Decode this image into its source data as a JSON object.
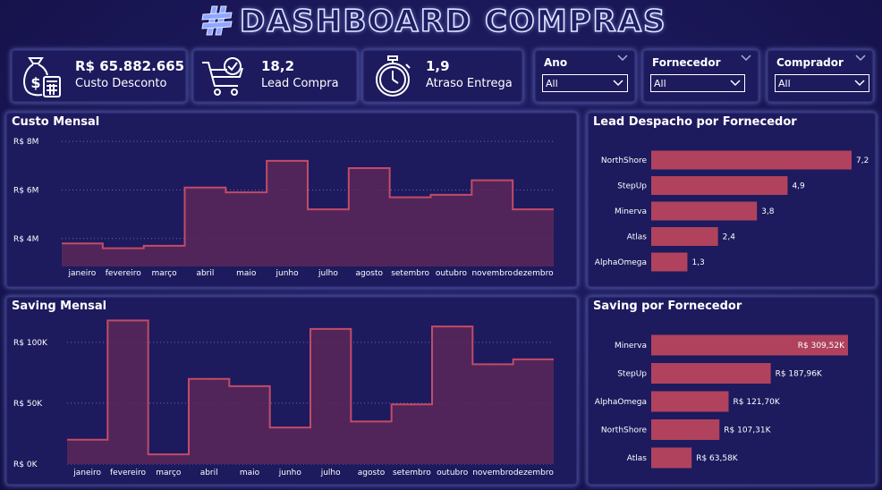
{
  "header": {
    "title": "DASHBOARD COMPRAS"
  },
  "kpis": [
    {
      "icon": "money-bag-calculator-icon",
      "value": "R$ 65.882.665",
      "label": "Custo Desconto"
    },
    {
      "icon": "shopping-cart-check-icon",
      "value": "18,2",
      "label": "Lead Compra"
    },
    {
      "icon": "stopwatch-icon",
      "value": "1,9",
      "label": "Atraso Entrega"
    }
  ],
  "filters": [
    {
      "label": "Ano",
      "value": "All"
    },
    {
      "label": "Fornecedor",
      "value": "All"
    },
    {
      "label": "Comprador",
      "value": "All"
    }
  ],
  "colors": {
    "accent": "#b0425e",
    "area_fill": "#5a2858",
    "line": "#c34b68",
    "background": "#1a1757"
  },
  "chart_data": [
    {
      "type": "area",
      "title": "Custo Mensal",
      "categories": [
        "janeiro",
        "fevereiro",
        "março",
        "abril",
        "maio",
        "junho",
        "julho",
        "agosto",
        "setembro",
        "outubro",
        "novembro",
        "dezembro"
      ],
      "values": [
        3.8,
        3.6,
        3.7,
        6.1,
        5.9,
        7.2,
        5.2,
        6.9,
        5.7,
        5.8,
        6.4,
        5.2
      ],
      "yticks": [
        "R$ 8M",
        "R$ 6M",
        "R$ 4M"
      ],
      "ytick_values": [
        8,
        6,
        4
      ],
      "ylim": [
        2.85,
        8.3
      ],
      "step": true
    },
    {
      "type": "bar",
      "title": "Lead Despacho por Fornecedor",
      "orientation": "horizontal",
      "categories": [
        "NorthShore",
        "StepUp",
        "Minerva",
        "Atlas",
        "AlphaOmega"
      ],
      "values": [
        7.2,
        4.9,
        3.8,
        2.4,
        1.3
      ],
      "labels": [
        "7,2",
        "4,9",
        "3,8",
        "2,4",
        "1,3"
      ]
    },
    {
      "type": "area",
      "title": "Saving Mensal",
      "categories": [
        "janeiro",
        "fevereiro",
        "março",
        "abril",
        "maio",
        "junho",
        "julho",
        "agosto",
        "setembro",
        "outubro",
        "novembro",
        "dezembro"
      ],
      "values": [
        20,
        118,
        8,
        70,
        64,
        30,
        111,
        35,
        49,
        113,
        82,
        86
      ],
      "yticks": [
        "R$ 100K",
        "R$ 50K",
        "R$ 0K"
      ],
      "ytick_values": [
        100,
        50,
        0
      ],
      "ylim": [
        0,
        130
      ],
      "step": true
    },
    {
      "type": "bar",
      "title": "Saving por Fornecedor",
      "orientation": "horizontal",
      "categories": [
        "Minerva",
        "StepUp",
        "AlphaOmega",
        "NorthShore",
        "Atlas"
      ],
      "values": [
        309.52,
        187.96,
        121.7,
        107.31,
        63.58
      ],
      "labels": [
        "R$ 309,52K",
        "R$ 187,96K",
        "R$ 121,70K",
        "R$ 107,31K",
        "R$ 63,58K"
      ]
    }
  ]
}
